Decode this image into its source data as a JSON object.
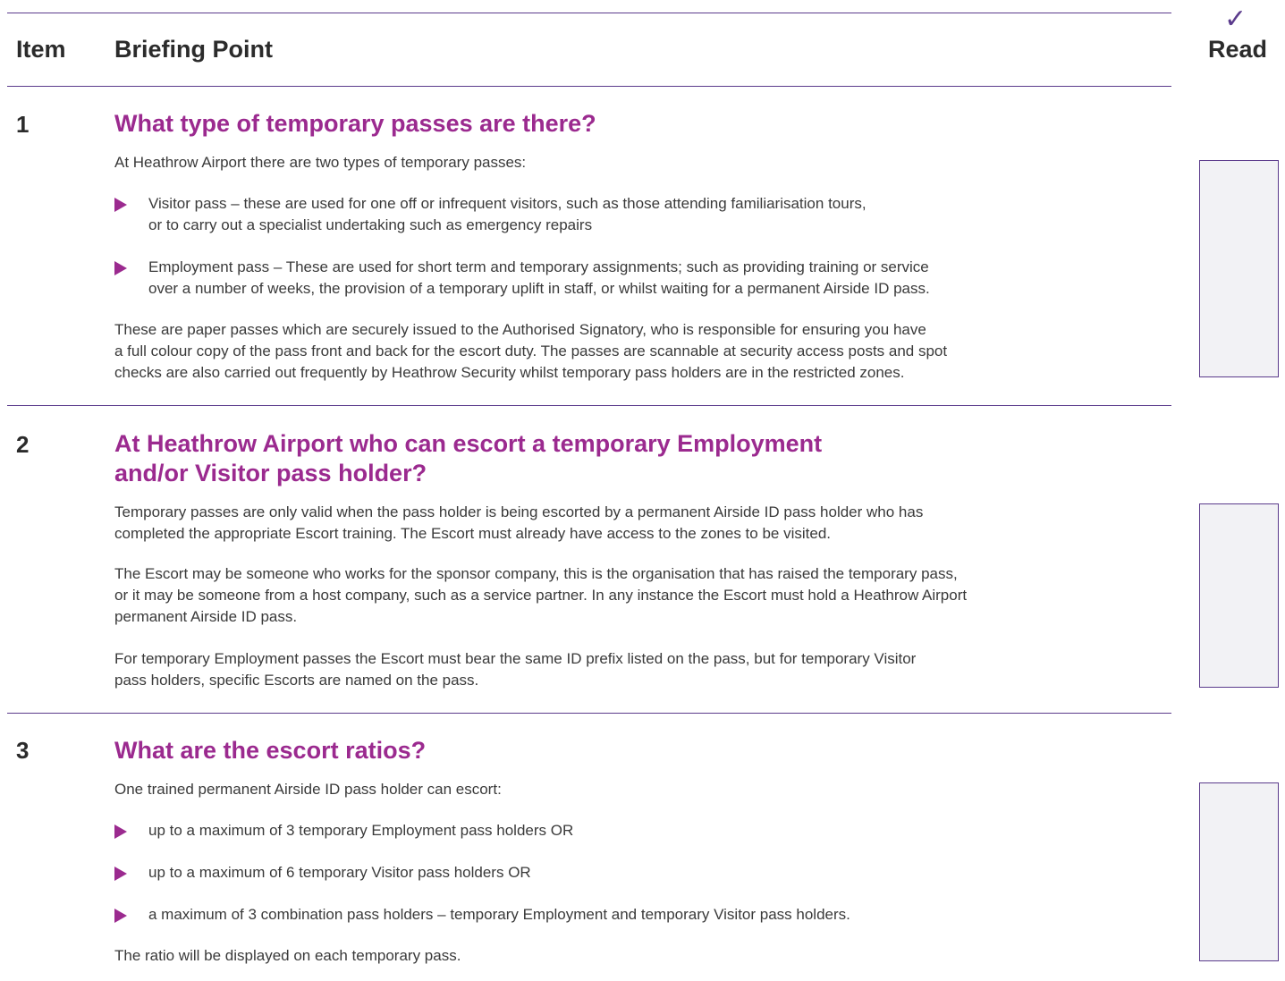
{
  "header": {
    "item_label": "Item",
    "point_label": "Briefing Point",
    "read_label": "Read"
  },
  "sections": [
    {
      "number": "1",
      "question": "What type of temporary passes are there?",
      "intro": "At Heathrow Airport there are two types of temporary passes:",
      "bullets": [
        [
          "Visitor pass – these are used for one off or infrequent visitors, such as those attending familiarisation tours,",
          "or to carry out a specialist undertaking such as emergency repairs"
        ],
        [
          "Employment pass – These are used for short term and temporary assignments; such as providing training or service",
          "over a number of weeks, the provision of a temporary uplift in staff, or whilst waiting for a permanent Airside ID pass."
        ]
      ],
      "closing": [
        "These are paper passes which are securely issued to the Authorised Signatory, who is responsible for ensuring you have",
        "a full colour copy of the pass front and back for the escort duty.  The passes are scannable at security access posts and spot",
        "checks are also carried out frequently by Heathrow Security whilst temporary pass holders are in the restricted zones."
      ]
    },
    {
      "number": "2",
      "question": [
        "At Heathrow Airport who can escort a temporary Employment",
        "and/or Visitor pass holder?"
      ],
      "paragraphs": [
        [
          "Temporary passes are only valid when the pass holder is being escorted by a permanent Airside ID pass holder who has",
          "completed the appropriate Escort training. The Escort must already have access to the zones to be visited."
        ],
        [
          "The Escort may be someone who works for the sponsor company, this is the organisation that has raised the temporary pass,",
          "or it may be someone from a host company, such as a service partner.  In any instance the Escort must hold a Heathrow Airport",
          "permanent Airside ID pass."
        ],
        [
          "For temporary Employment passes the Escort must bear the same ID prefix listed on the pass, but for temporary Visitor",
          "pass holders, specific Escorts are named on the pass."
        ]
      ]
    },
    {
      "number": "3",
      "question": "What are the escort ratios?",
      "intro": "One trained permanent Airside ID pass holder can escort:",
      "bullets": [
        "up to a maximum of 3 temporary Employment pass holders OR",
        "up to a maximum of 6 temporary Visitor pass holders OR",
        "a maximum of 3 combination pass holders – temporary Employment and temporary Visitor pass holders."
      ],
      "closing": "The ratio will be displayed on each temporary pass."
    }
  ]
}
